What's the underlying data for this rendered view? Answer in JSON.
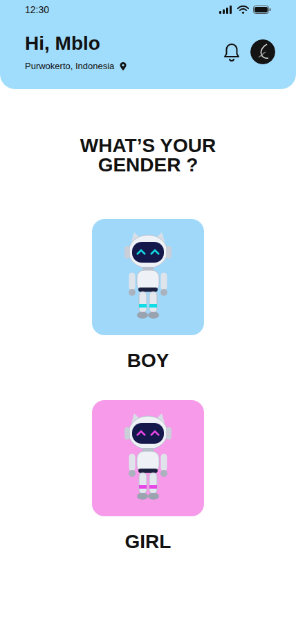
{
  "status_bar": {
    "time": "12:30"
  },
  "header": {
    "greeting": "Hi, Mblo",
    "location": "Purwokerto, Indonesia"
  },
  "title": "WHAT’S YOUR GENDER ?",
  "options": [
    {
      "label": "BOY",
      "color": "#a0d8fa",
      "selected": false
    },
    {
      "label": "GIRL",
      "color": "#f69ae9",
      "selected": false
    }
  ]
}
